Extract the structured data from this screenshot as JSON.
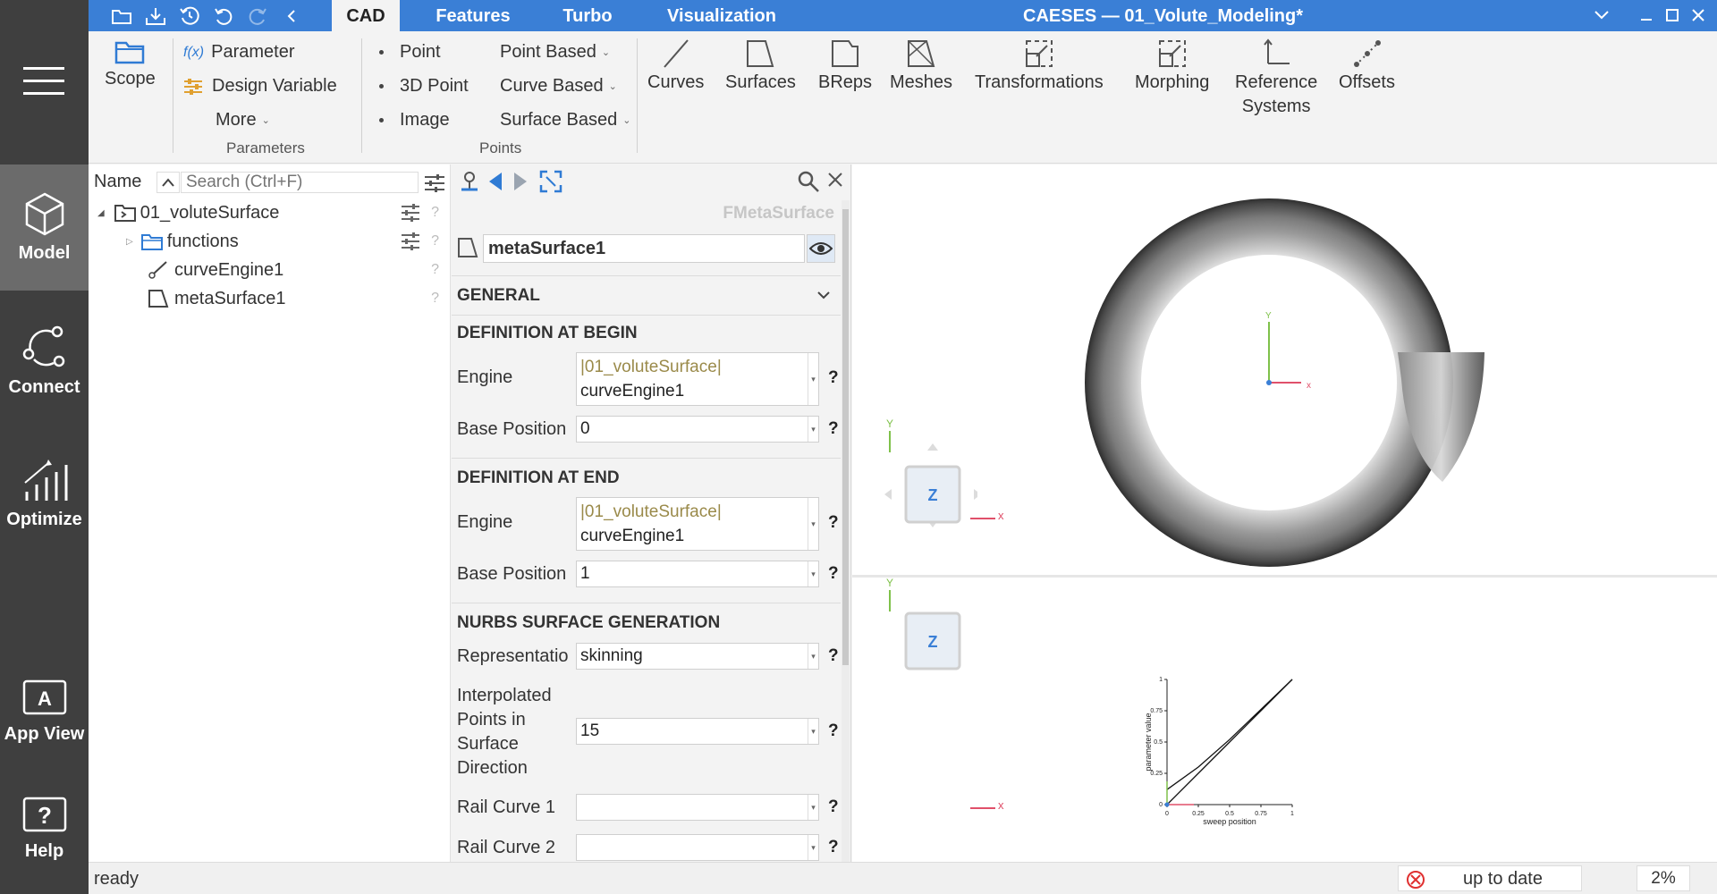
{
  "window": {
    "title": "CAESES — 01_Volute_Modeling*"
  },
  "tabs": [
    "CAD",
    "Features",
    "Turbo",
    "Visualization"
  ],
  "active_tab": "CAD",
  "sidebar": {
    "items": [
      {
        "label": "Model",
        "icon": "cube-icon",
        "active": true
      },
      {
        "label": "Connect",
        "icon": "connect-icon",
        "active": false
      },
      {
        "label": "Optimize",
        "icon": "chart-up-icon",
        "active": false
      },
      {
        "label": "App View",
        "icon": "app-view-icon",
        "active": false
      },
      {
        "label": "Help",
        "icon": "help-icon",
        "active": false
      }
    ]
  },
  "ribbon": {
    "scope": "Scope",
    "parameter": "Parameter",
    "parameter_fx": "f(x)",
    "design_variable": "Design Variable",
    "more": "More",
    "parameters_group": "Parameters",
    "point": "Point",
    "point3d": "3D Point",
    "image": "Image",
    "point_based": "Point Based",
    "curve_based": "Curve Based",
    "surface_based": "Surface Based",
    "points_group": "Points",
    "curves": "Curves",
    "surfaces": "Surfaces",
    "breps": "BReps",
    "meshes": "Meshes",
    "transformations": "Transformations",
    "morphing": "Morphing",
    "reference": "Reference",
    "systems": "Systems",
    "offsets": "Offsets"
  },
  "tree": {
    "column_name": "Name",
    "search_placeholder": "Search (Ctrl+F)",
    "items": [
      {
        "label": "01_voluteSurface",
        "level": 0
      },
      {
        "label": "functions",
        "level": 1
      },
      {
        "label": "curveEngine1",
        "level": 1
      },
      {
        "label": "metaSurface1",
        "level": 1
      }
    ],
    "question": "?"
  },
  "properties": {
    "type_name": "FMetaSurface",
    "object_name": "metaSurface1",
    "general": "GENERAL",
    "def_begin": "DEFINITION AT BEGIN",
    "engine_label": "Engine",
    "engine_begin_ctx": "|01_voluteSurface|",
    "engine_begin_val": "curveEngine1",
    "base_pos_label": "Base Position",
    "base_pos_begin": "0",
    "def_end": "DEFINITION AT END",
    "engine_end_ctx": "|01_voluteSurface|",
    "engine_end_val": "curveEngine1",
    "base_pos_end": "1",
    "nurbs": "NURBS SURFACE GENERATION",
    "representation_label": "Representatio",
    "representation_val": "skinning",
    "interp_label_1": "Interpolated",
    "interp_label_2": "Points in",
    "interp_label_3": "Surface",
    "interp_label_4": "Direction",
    "interp_val": "15",
    "rail1_label": "Rail Curve 1",
    "rail2_label": "Rail Curve 2",
    "qm": "?"
  },
  "viewport": {
    "axis_x": "x",
    "axis_y": "Y",
    "axis_z": "Z"
  },
  "chart_data": {
    "type": "line",
    "xlabel": "sweep position",
    "ylabel": "parameter value",
    "xlim": [
      0,
      1
    ],
    "ylim": [
      0,
      1
    ],
    "x_ticks": [
      "0",
      "0.25",
      "0.5",
      "0.75",
      "1"
    ],
    "y_ticks": [
      "0",
      "0.25",
      "0.5",
      "0.75",
      "1"
    ],
    "series": [
      {
        "x": [
          0,
          0.25,
          0.5,
          0.75,
          1
        ],
        "y": [
          0,
          0.25,
          0.5,
          0.75,
          1
        ]
      },
      {
        "x": [
          0,
          0.25,
          0.5,
          0.75,
          1
        ],
        "y": [
          0.12,
          0.3,
          0.52,
          0.76,
          1
        ]
      }
    ]
  },
  "status": {
    "left": "ready",
    "center": "up to date",
    "percent": "2%"
  }
}
